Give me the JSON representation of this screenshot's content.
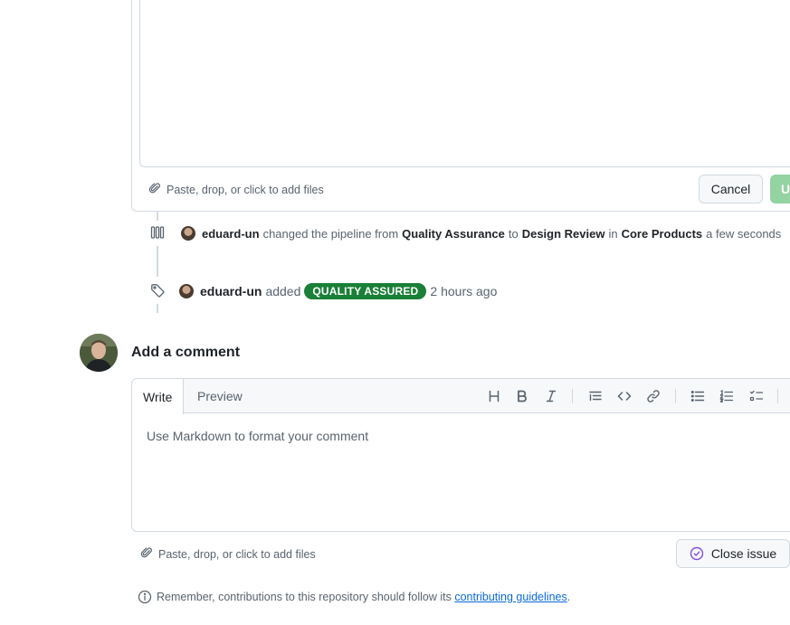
{
  "edit": {
    "attach_text": "Paste, drop, or click to add files",
    "cancel_label": "Cancel",
    "update_label": "U"
  },
  "timeline": {
    "event1": {
      "user": "eduard-un",
      "text1": "changed the pipeline from",
      "from": "Quality Assurance",
      "text2": "to",
      "to": "Design Review",
      "text3": "in",
      "project": "Core Products",
      "time": "a few seconds"
    },
    "event2": {
      "user": "eduard-un",
      "text1": "added",
      "label": "QUALITY ASSURED",
      "time": "2 hours ago"
    }
  },
  "comment": {
    "title": "Add a comment",
    "tab_write": "Write",
    "tab_preview": "Preview",
    "placeholder": "Use Markdown to format your comment",
    "attach_text": "Paste, drop, or click to add files",
    "close_issue_label": "Close issue",
    "note_text": "Remember, contributions to this repository should follow its",
    "note_link": "contributing guidelines",
    "note_end": "."
  },
  "colors": {
    "label_green": "#1a7f37",
    "link_blue": "#0969da",
    "update_disabled_green": "#94d3a2",
    "close_issue_purple": "#8250df"
  },
  "icons": {
    "attach": "paperclip-icon",
    "pipeline": "columns-icon",
    "label": "tag-icon",
    "info": "info-icon",
    "close_issue": "issue-closed-icon"
  }
}
